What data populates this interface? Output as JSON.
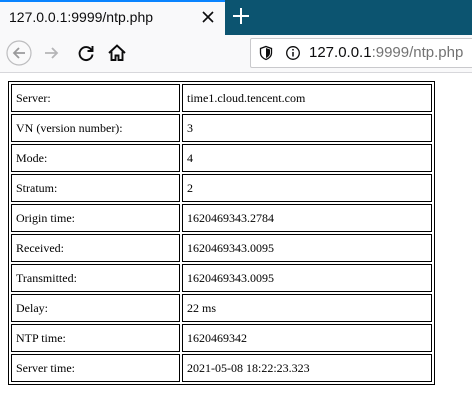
{
  "tab": {
    "title": "127.0.0.1:9999/ntp.php"
  },
  "url": {
    "host": "127.0.0.1",
    "rest": ":9999/ntp.php"
  },
  "rows": [
    {
      "key": "Server:",
      "value": "time1.cloud.tencent.com"
    },
    {
      "key": "VN (version number):",
      "value": "3"
    },
    {
      "key": "Mode:",
      "value": "4"
    },
    {
      "key": "Stratum:",
      "value": "2"
    },
    {
      "key": "Origin time:",
      "value": "1620469343.2784"
    },
    {
      "key": "Received:",
      "value": "1620469343.0095"
    },
    {
      "key": "Transmitted:",
      "value": "1620469343.0095"
    },
    {
      "key": "Delay:",
      "value": "22 ms"
    },
    {
      "key": "NTP time:",
      "value": "1620469342"
    },
    {
      "key": "Server time:",
      "value": "2021-05-08 18:22:23.323"
    }
  ],
  "colors": {
    "tabstrip": "#0c5470",
    "accent": "#0a84ff"
  },
  "icons": [
    "close-icon",
    "plus-icon",
    "back-arrow-icon",
    "forward-arrow-icon",
    "reload-icon",
    "home-icon",
    "shield-icon",
    "info-icon"
  ]
}
